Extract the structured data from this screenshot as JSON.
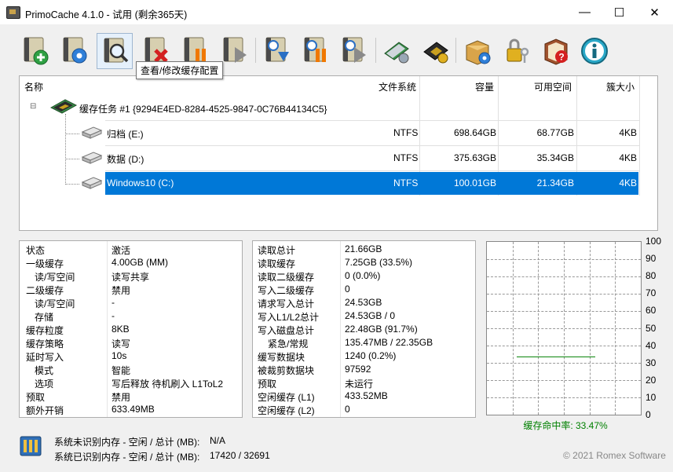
{
  "window": {
    "title": "PrimoCache 4.1.0 - 试用 (剩余365天)",
    "minimize": "—",
    "maximize": "☐",
    "close": "✕"
  },
  "toolbar": {
    "buttons": [
      {
        "icon": "add-disk-icon",
        "hint": ""
      },
      {
        "icon": "gear-disk-icon",
        "hint": ""
      },
      {
        "icon": "search-disk-icon",
        "hint": "查看/修改缓存配置"
      },
      {
        "icon": "delete-disk-icon",
        "hint": ""
      },
      {
        "icon": "pause-disk-icon",
        "hint": ""
      },
      {
        "icon": "play-disk-icon",
        "hint": ""
      },
      {
        "icon": "flush-disk-icon",
        "hint": ""
      },
      {
        "icon": "pause-all-icon",
        "hint": ""
      },
      {
        "icon": "resume-all-icon",
        "hint": ""
      },
      {
        "icon": "memory-module-icon",
        "hint": ""
      },
      {
        "icon": "cpu-chip-icon",
        "hint": ""
      },
      {
        "icon": "package-gear-icon",
        "hint": ""
      },
      {
        "icon": "key-lock-icon",
        "hint": ""
      },
      {
        "icon": "help-book-icon",
        "hint": ""
      },
      {
        "icon": "info-icon",
        "hint": ""
      }
    ],
    "tooltip": "查看/修改缓存配置"
  },
  "tree": {
    "columns": {
      "name": "名称",
      "fs": "文件系统",
      "capacity": "容量",
      "free": "可用空间",
      "cluster": "簇大小"
    },
    "task": {
      "toggle": "⊟",
      "label": "缓存任务 #1 {9294E4ED-8284-4525-9847-0C76B44134C5}"
    },
    "volumes": [
      {
        "name": "归档 (E:)",
        "fs": "NTFS",
        "capacity": "698.64GB",
        "free": "68.77GB",
        "cluster": "4KB"
      },
      {
        "name": "数据 (D:)",
        "fs": "NTFS",
        "capacity": "375.63GB",
        "free": "35.34GB",
        "cluster": "4KB"
      },
      {
        "name": "Windows10 (C:)",
        "fs": "NTFS",
        "capacity": "100.01GB",
        "free": "21.34GB",
        "cluster": "4KB"
      }
    ],
    "selected_index": 2
  },
  "config_panel": [
    {
      "label": "状态",
      "value": "激活",
      "indent": 0
    },
    {
      "label": "一级缓存",
      "value": "4.00GB (MM)",
      "indent": 0
    },
    {
      "label": "读/写空间",
      "value": "读写共享",
      "indent": 1
    },
    {
      "label": "二级缓存",
      "value": "禁用",
      "indent": 0
    },
    {
      "label": "读/写空间",
      "value": "-",
      "indent": 1
    },
    {
      "label": "存储",
      "value": "-",
      "indent": 1
    },
    {
      "label": "缓存粒度",
      "value": "8KB",
      "indent": 0
    },
    {
      "label": "缓存策略",
      "value": "读写",
      "indent": 0
    },
    {
      "label": "延时写入",
      "value": "10s",
      "indent": 0
    },
    {
      "label": "模式",
      "value": "智能",
      "indent": 1
    },
    {
      "label": "选项",
      "value": "写后释放 待机刷入 L1ToL2",
      "indent": 1
    },
    {
      "label": "预取",
      "value": "禁用",
      "indent": 0
    },
    {
      "label": "额外开销",
      "value": "633.49MB",
      "indent": 0
    }
  ],
  "stats_panel": [
    {
      "label": "读取总计",
      "value": "21.66GB",
      "indent": 0
    },
    {
      "label": "读取缓存",
      "value": "7.25GB (33.5%)",
      "indent": 0
    },
    {
      "label": "读取二级缓存",
      "value": "0 (0.0%)",
      "indent": 0
    },
    {
      "label": "写入二级缓存",
      "value": "0",
      "indent": 0
    },
    {
      "label": "请求写入总计",
      "value": "24.53GB",
      "indent": 0
    },
    {
      "label": "写入L1/L2总计",
      "value": "24.53GB / 0",
      "indent": 0
    },
    {
      "label": "写入磁盘总计",
      "value": "22.48GB (91.7%)",
      "indent": 0
    },
    {
      "label": "紧急/常规",
      "value": "135.47MB / 22.35GB",
      "indent": 1
    },
    {
      "label": "缓写数据块",
      "value": "1240 (0.2%)",
      "indent": 0
    },
    {
      "label": "被裁剪数据块",
      "value": "97592",
      "indent": 0
    },
    {
      "label": "预取",
      "value": "未运行",
      "indent": 0
    },
    {
      "label": "空闲缓存 (L1)",
      "value": "433.52MB",
      "indent": 0
    },
    {
      "label": "空闲缓存 (L2)",
      "value": "0",
      "indent": 0
    }
  ],
  "chart_data": {
    "type": "line",
    "ylim": [
      0,
      100
    ],
    "yticks": [
      "100",
      "90",
      "80",
      "70",
      "60",
      "50",
      "40",
      "30",
      "20",
      "10",
      "0"
    ],
    "series": [
      {
        "values": [
          33.47,
          33.47,
          33.47,
          33.47,
          33.47
        ]
      }
    ],
    "caption": "缓存命中率: 33.47%",
    "line_color": "#008000"
  },
  "footer": {
    "unrecognized_label": "系统未识别内存 - 空闲 / 总计 (MB):",
    "unrecognized_value": "N/A",
    "recognized_label": "系统已识别内存 - 空闲 / 总计 (MB):",
    "recognized_value": "17420 / 32691",
    "copyright": "© 2021 Romex Software"
  }
}
